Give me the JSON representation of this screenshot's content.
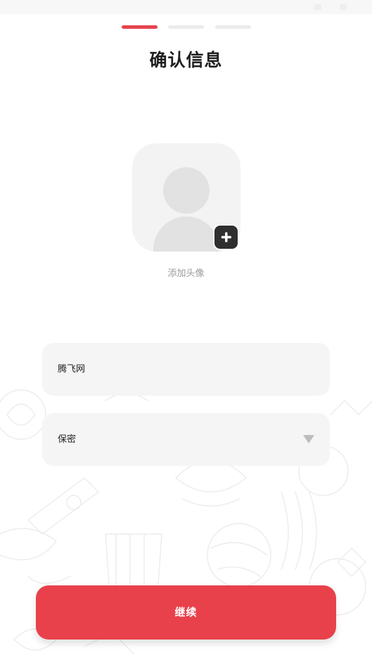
{
  "onboarding": {
    "steps_total": 3,
    "current_step": 1,
    "title": "确认信息"
  },
  "avatar": {
    "caption": "添加头像",
    "add_icon": "plus-icon"
  },
  "form": {
    "nickname_value": "腾飞网",
    "gender_value": "保密",
    "gender_icon": "chevron-down-icon"
  },
  "actions": {
    "continue_label": "继续"
  },
  "colors": {
    "accent": "#e8414b",
    "progress_inactive": "#ebebeb",
    "field_bg": "#f5f5f5",
    "badge_bg": "#2f2f2f"
  }
}
